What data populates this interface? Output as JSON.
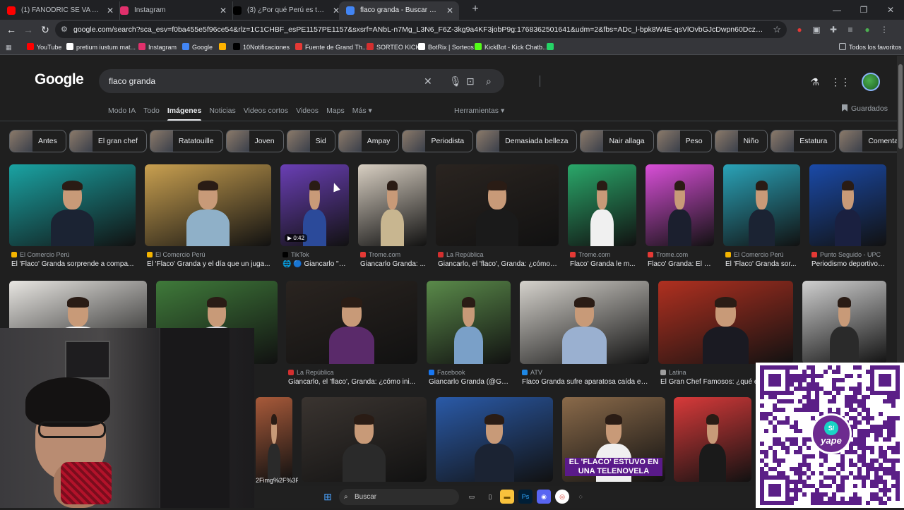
{
  "browser": {
    "tabs": [
      {
        "title": "(1) FANODRIC SE VA A KICK 😱",
        "icon_color": "#ff0000",
        "active": false
      },
      {
        "title": "Instagram",
        "icon_color": "#e1306c",
        "active": false
      },
      {
        "title": "(3) ¿Por qué Perú es tendencia?",
        "icon_color": "#000000",
        "active": false
      },
      {
        "title": "flaco granda - Buscar con Google",
        "icon_color": "#4285f4",
        "active": true
      }
    ],
    "url": "google.com/search?sca_esv=f0ba455e5f96ce54&rlz=1C1CHBF_esPE1157PE1157&sxsrf=ANbL-n7Mg_L3N6_F6Z-3kg9a4KF3jobP9g:1768362501641&udm=2&fbs=ADc_l-bpk8W4E-qsVlOvbGJcDwpn60DczFdcvPnuv8WQohHLTbSVldBrj9md...",
    "bookmarks": [
      {
        "label": "YouTube",
        "color": "#ff0000"
      },
      {
        "label": "pretium iustum mat...",
        "color": "#ffffff"
      },
      {
        "label": "Instagram",
        "color": "#e1306c"
      },
      {
        "label": "Google",
        "color": "#4285f4"
      },
      {
        "label": "",
        "color": "#ffb300"
      },
      {
        "label": "10Notificaciones",
        "color": "#000000"
      },
      {
        "label": "Fuente de Grand Th...",
        "color": "#e53935"
      },
      {
        "label": "SORTEO KICK",
        "color": "#d32f2f"
      },
      {
        "label": "BotRix | Sorteos",
        "color": "#ffffff"
      },
      {
        "label": "KickBot - Kick Chatb...",
        "color": "#53fc18"
      },
      {
        "label": "",
        "color": "#25d366"
      }
    ],
    "all_bookmarks": "Todos los favoritos"
  },
  "google": {
    "logo": "Google",
    "query": "flaco granda",
    "tabs": [
      "Modo IA",
      "Todo",
      "Imágenes",
      "Noticias",
      "Videos cortos",
      "Videos",
      "Maps",
      "Más ▾"
    ],
    "active_tab": "Imágenes",
    "tools": "Herramientas ▾",
    "saved": "Guardados",
    "chips": [
      "Antes",
      "El gran chef",
      "Ratatouille",
      "Joven",
      "Sid",
      "Ampay",
      "Periodista",
      "Demasiada belleza",
      "Nair allaga",
      "Peso",
      "Niño",
      "Estatura",
      "Comentarista deport"
    ]
  },
  "results_row1": [
    {
      "source": "El Comercio Perú",
      "title": "El 'Flaco' Granda sorprende a compa...",
      "src_color": "#f4b400",
      "bg": "#1aa3a3",
      "shirt": "#1b2333"
    },
    {
      "source": "El Comercio Perú",
      "title": "El 'Flaco' Granda y el día que un juga...",
      "src_color": "#f4b400",
      "bg": "#c9a050",
      "shirt": "#8fb0c8"
    },
    {
      "source": "TikTok",
      "title": "🌐 🔵 Giancarlo \"e...",
      "src_color": "#000000",
      "bg": "#6a3fb5",
      "shirt": "#2b4a9a",
      "badge": "▶ 0:42"
    },
    {
      "source": "Trome.com",
      "title": "Giancarlo Granda: ...",
      "src_color": "#e53935",
      "bg": "#d8cfc2",
      "shirt": "#c8b690"
    },
    {
      "source": "La República",
      "title": "Giancarlo, el 'flaco', Granda: ¿cómo i...",
      "src_color": "#d32f2f",
      "bg": "#2a2420",
      "shirt": "#1a1a1a"
    },
    {
      "source": "Trome.com",
      "title": "Flaco' Granda le m...",
      "src_color": "#e53935",
      "bg": "#2aa86a",
      "shirt": "#f0f0f0"
    },
    {
      "source": "Trome.com",
      "title": "Flaco' Granda: El s...",
      "src_color": "#e53935",
      "bg": "#d94fd8",
      "shirt": "#1b1f2e"
    },
    {
      "source": "El Comercio Perú",
      "title": "El 'Flaco' Granda sor...",
      "src_color": "#f4b400",
      "bg": "#2aa3b8",
      "shirt": "#1b2333"
    },
    {
      "source": "Punto Seguido - UPC",
      "title": "Periodismo deportivo ...",
      "src_color": "#e53935",
      "bg": "#1a4aa8",
      "shirt": "#1a2040"
    }
  ],
  "results_row2": [
    {
      "source": "",
      "title": "",
      "bg": "#e8e6e2",
      "shirt": "#f5f5f5"
    },
    {
      "source": "",
      "title": "lo G...",
      "bg": "#3f7a3a",
      "shirt": "#d8d8e0"
    },
    {
      "source": "La República",
      "title": "Giancarlo, el 'flaco', Granda: ¿cómo ini...",
      "src_color": "#d32f2f",
      "bg": "#2a2420",
      "shirt": "#5a2a6a"
    },
    {
      "source": "Facebook",
      "title": "Giancarlo Granda (@Gg...",
      "src_color": "#1877f2",
      "bg": "#5a8a4a",
      "shirt": "#7aa0c8"
    },
    {
      "source": "ATV",
      "title": "Flaco Granda sufre aparatosa caída en...",
      "src_color": "#1e88e5",
      "bg": "#d5d2cc",
      "shirt": "#9ab0d0"
    },
    {
      "source": "Latina",
      "title": "El Gran Chef Famosos: ¿qué e",
      "src_color": "#9e9e9e",
      "bg": "#b03020",
      "shirt": "#1a1a22"
    },
    {
      "source": "",
      "title": "",
      "bg": "#cfcfcf",
      "shirt": "#2a2a2a"
    }
  ],
  "results_row3": [
    {
      "title": "2Fimg%2F%3Fi...",
      "bg": "#a85a3a",
      "shirt": "#2a2a2a"
    },
    {
      "bg": "#3a3430",
      "shirt": "#2a2a2a"
    },
    {
      "bg": "#2a5aa8",
      "shirt": "#1b2333"
    },
    {
      "bg": "#8a6a4a",
      "shirt": "#f0f0f0",
      "caption": "EL 'FLACO' ESTUVO EN UNA TELENOVELA"
    },
    {
      "bg": "#d83a3a",
      "shirt": "#1a1a1a"
    }
  ],
  "taskbar": {
    "search": "Buscar"
  },
  "qr": {
    "brand": "yape",
    "symbol": "S/"
  }
}
